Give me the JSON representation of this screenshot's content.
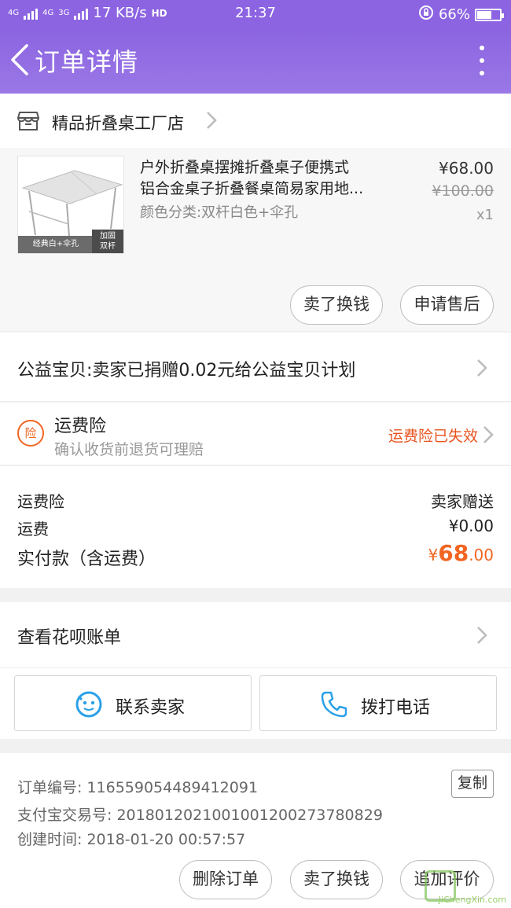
{
  "status_bar": {
    "network_1": "4G",
    "network_2": "4G",
    "network_3": "3G",
    "speed": "17 KB/s",
    "hd": "HD",
    "time": "21:37",
    "battery": "66%",
    "battery_level": 0.66
  },
  "header": {
    "title": "订单详情",
    "back_icon": "chevron-left-icon",
    "more_icon": "more-vertical-icon"
  },
  "shop": {
    "name": "精品折叠桌工厂店",
    "icon": "store-icon"
  },
  "item": {
    "title_line1": "户外折叠桌摆摊折叠桌子便携式",
    "title_line2": "铝合金桌子折叠餐桌简易家用地...",
    "spec": "颜色分类:双杆白色+伞孔",
    "price": "¥68.00",
    "original_price": "¥100.00",
    "quantity": "x1",
    "image_tag_left": "经典白+伞孔",
    "image_tag_right_1": "加固",
    "image_tag_right_2": "双杆",
    "actions": {
      "resell": "卖了换钱",
      "aftersale": "申请售后"
    }
  },
  "charity": {
    "text": "公益宝贝:卖家已捐赠0.02元给公益宝贝计划"
  },
  "insurance": {
    "badge": "险",
    "title": "运费险",
    "subtitle": "确认收货前退货可理赔",
    "status": "运费险已失效"
  },
  "fees": {
    "insurance_label": "运费险",
    "insurance_value": "卖家赠送",
    "shipping_label": "运费",
    "shipping_value": "¥0.00",
    "total_label": "实付款（含运费）",
    "total_currency": "¥",
    "total_int": "68",
    "total_dec": ".00"
  },
  "huabei": {
    "text": "查看花呗账单"
  },
  "contact": {
    "seller": "联系卖家",
    "phone": "拨打电话"
  },
  "order_info": {
    "order_no": "订单编号: 116559054489412091",
    "copy": "复制",
    "alipay_no": "支付宝交易号: 2018012021001001200273780829",
    "created": "创建时间: 2018-01-20 00:57:57"
  },
  "bottom_actions": {
    "delete": "删除订单",
    "resell": "卖了换钱",
    "review": "追加评价"
  },
  "watermark": "JiChengXin.com",
  "colors": {
    "header": "#8c64e2",
    "accent_orange": "#f26522",
    "icon_blue": "#2aa0e8"
  }
}
